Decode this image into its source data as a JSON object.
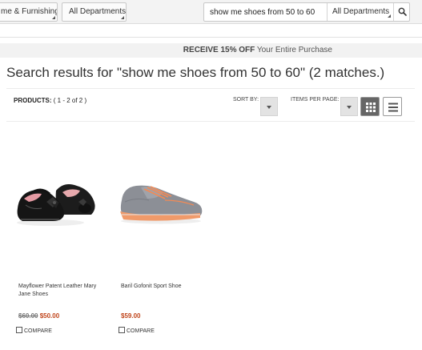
{
  "nav": {
    "category_label": "me & Furnishing",
    "departments_label": "All Departments"
  },
  "search": {
    "query": "show me shoes from 50 to 60",
    "department": "All Departments"
  },
  "promo": {
    "highlight": "RECEIVE 15% OFF",
    "rest": " Your Entire Purchase"
  },
  "results": {
    "title": "Search results for \"show me shoes from 50 to 60\" (2 matches.)",
    "products_label": "PRODUCTS:",
    "products_range": " ( 1 - 2 of 2 )",
    "sort_label": "SORT BY:",
    "perpage_label": "ITEMS PER PAGE:"
  },
  "products": [
    {
      "name": "Mayflower Patent Leather Mary Jane Shoes",
      "old_price": "$60.00",
      "price": "$50.00",
      "compare_label": "COMPARE"
    },
    {
      "name": "Baril Gofonit Sport Shoe",
      "old_price": "",
      "price": "$59.00",
      "compare_label": "COMPARE"
    }
  ],
  "icons": {
    "search": "magnifier-icon",
    "grid_view": "grid-view-icon",
    "list_view": "list-view-icon"
  },
  "colors": {
    "sale_price": "#c0451b",
    "active_view": "#666666"
  }
}
